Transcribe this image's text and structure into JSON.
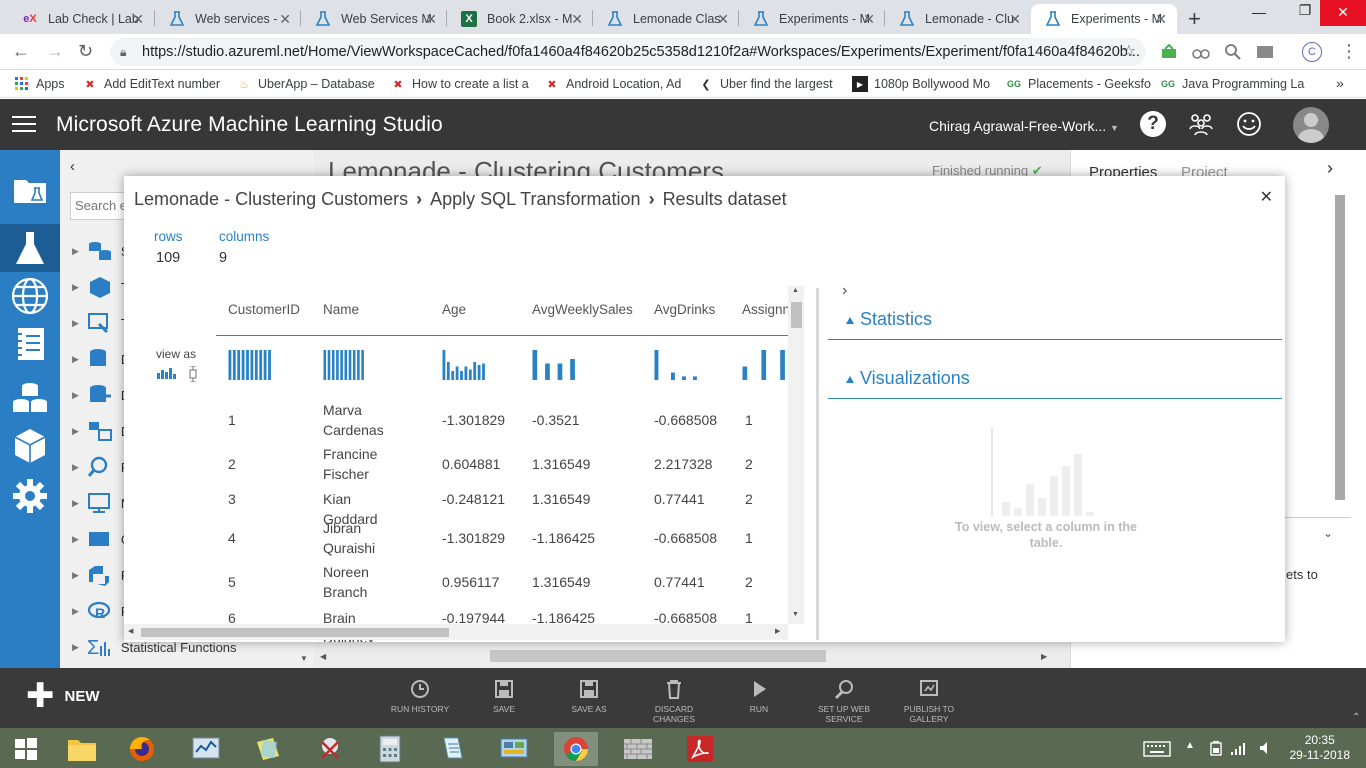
{
  "browser": {
    "tabs": [
      {
        "label": "Lab Check | Lab",
        "icon": "ex-icon"
      },
      {
        "label": "Web services -",
        "icon": "flask-icon"
      },
      {
        "label": "Web Services M",
        "icon": "flask-icon"
      },
      {
        "label": "Book 2.xlsx - M",
        "icon": "excel-icon"
      },
      {
        "label": "Lemonade Clas",
        "icon": "flask-icon"
      },
      {
        "label": "Experiments - M",
        "icon": "flask-icon"
      },
      {
        "label": "Lemonade - Clu",
        "icon": "flask-icon"
      },
      {
        "label": "Experiments - M",
        "icon": "flask-icon"
      }
    ],
    "url": "https://studio.azureml.net/Home/ViewWorkspaceCached/f0fa1460a4f84620b25c5358d1210f2a#Workspaces/Experiments/Experiment/f0fa1460a4f84620b...",
    "profile_initial": "C",
    "bookmarks": [
      {
        "label": "Apps"
      },
      {
        "label": "Add EditText number"
      },
      {
        "label": "UberApp – Database"
      },
      {
        "label": "How to create a list a"
      },
      {
        "label": "Android Location, Ad"
      },
      {
        "label": "Uber find the largest"
      },
      {
        "label": "1080p Bollywood Mo"
      },
      {
        "label": "Placements - Geeksfo"
      },
      {
        "label": "Java Programming La"
      }
    ]
  },
  "app": {
    "title": "Microsoft Azure Machine Learning Studio",
    "user": "Chirag Agrawal-Free-Work...",
    "help": "?"
  },
  "palette": {
    "search_placeholder": "Search e",
    "items": [
      {
        "label": "S"
      },
      {
        "label": "T"
      },
      {
        "label": "T"
      },
      {
        "label": "D"
      },
      {
        "label": "D"
      },
      {
        "label": "D"
      },
      {
        "label": "F"
      },
      {
        "label": "M"
      },
      {
        "label": "O"
      },
      {
        "label": "P"
      },
      {
        "label": "R"
      },
      {
        "label": "Statistical Functions"
      }
    ]
  },
  "background": {
    "experiment_title": "Lemonade - Clustering Customers",
    "status": "Finished running",
    "properties_tab": "Properties",
    "project_tab": "Project",
    "partial_text": "ets to"
  },
  "commands": [
    {
      "label": "RUN HISTORY"
    },
    {
      "label": "SAVE"
    },
    {
      "label": "SAVE AS"
    },
    {
      "label": "DISCARD CHANGES"
    },
    {
      "label": "RUN"
    },
    {
      "label": "SET UP WEB SERVICE"
    },
    {
      "label": "PUBLISH TO GALLERY"
    }
  ],
  "new_label": "NEW",
  "modal": {
    "crumbs": [
      "Lemonade - Clustering Customers",
      "Apply SQL Transformation",
      "Results dataset"
    ],
    "rows_label": "rows",
    "rows_value": "109",
    "columns_label": "columns",
    "columns_value": "9",
    "view_as": "view as",
    "headers": [
      "CustomerID",
      "Name",
      "Age",
      "AvgWeeklySales",
      "AvgDrinks",
      "Assignn"
    ],
    "histograms": {
      "CustomerID": [
        1,
        1,
        1,
        1,
        1,
        1,
        1,
        1,
        1,
        1
      ],
      "Name": [
        1,
        1,
        1,
        1,
        1,
        1,
        1,
        1,
        1,
        1
      ],
      "Age": [
        1.0,
        0.6,
        0.3,
        0.45,
        0.3,
        0.45,
        0.35,
        0.6,
        0.5,
        0.55
      ],
      "AvgWeeklySales": [
        1.0,
        0,
        0.55,
        0,
        0.55,
        0,
        0.7
      ],
      "AvgDrinks": [
        1.0,
        0,
        0,
        0.25,
        0,
        0.12,
        0,
        0.12
      ],
      "Assignn": [
        0.45,
        0,
        0,
        1.0,
        0,
        0,
        1.0
      ]
    },
    "rows": [
      {
        "id": "1",
        "name": "Marva Cardenas",
        "age": "-1.301829",
        "sales": "-0.3521",
        "drinks": "-0.668508",
        "assign": "1"
      },
      {
        "id": "2",
        "name": "Francine Fischer",
        "age": "0.604881",
        "sales": "1.316549",
        "drinks": "2.217328",
        "assign": "2"
      },
      {
        "id": "3",
        "name": "Kian Goddard",
        "age": "-0.248121",
        "sales": "1.316549",
        "drinks": "0.77441",
        "assign": "2"
      },
      {
        "id": "4",
        "name": "Jibran Quraishi",
        "age": "-1.301829",
        "sales": "-1.186425",
        "drinks": "-0.668508",
        "assign": "1"
      },
      {
        "id": "5",
        "name": "Noreen Branch",
        "age": "0.956117",
        "sales": "1.316549",
        "drinks": "0.77441",
        "assign": "2"
      },
      {
        "id": "6",
        "name": "Brain Dulaney",
        "age": "-0.197944",
        "sales": "-1.186425",
        "drinks": "-0.668508",
        "assign": "1"
      }
    ],
    "statistics": "Statistics",
    "visualizations": "Visualizations",
    "viz_hint": "To view, select a column in the table."
  },
  "taskbar": {
    "time": "20:35",
    "date": "29-11-2018"
  }
}
